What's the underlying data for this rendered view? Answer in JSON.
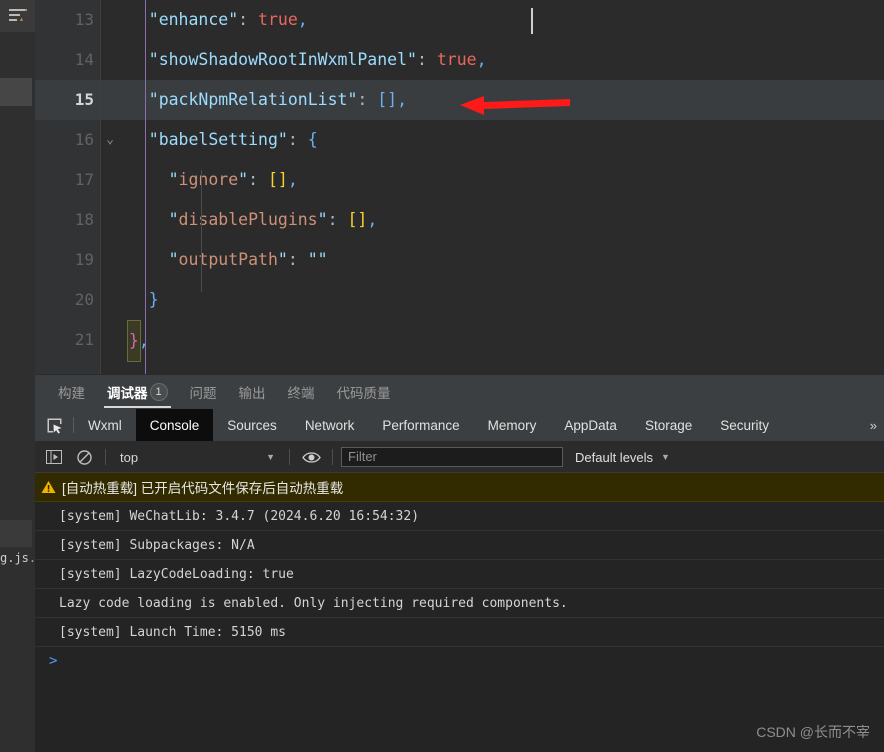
{
  "rail": {
    "outline_icon": "outline-list-icon",
    "file_label_prefix": "g.js",
    "file_label_ellipsis": "..."
  },
  "editor": {
    "lines": [
      {
        "number": "13",
        "active": false,
        "fold": "",
        "indent": "    ",
        "key": "enhance",
        "kind": "top",
        "value": "true",
        "value_kind": "bool",
        "trail": ","
      },
      {
        "number": "14",
        "active": false,
        "fold": "",
        "indent": "    ",
        "key": "showShadowRootInWxmlPanel",
        "kind": "top",
        "value": "true",
        "value_kind": "bool",
        "trail": ","
      },
      {
        "number": "15",
        "active": true,
        "fold": "",
        "indent": "    ",
        "key": "packNpmRelationList",
        "kind": "top",
        "value": "[]",
        "value_kind": "array-blue",
        "trail": ","
      },
      {
        "number": "16",
        "active": false,
        "fold": "chevron-down-icon",
        "indent": "    ",
        "key": "babelSetting",
        "kind": "top",
        "value": "{",
        "value_kind": "brace",
        "trail": ""
      },
      {
        "number": "17",
        "active": false,
        "fold": "",
        "indent": "      ",
        "key": "ignore",
        "kind": "nested",
        "value": "[]",
        "value_kind": "array-yellow",
        "trail": ","
      },
      {
        "number": "18",
        "active": false,
        "fold": "",
        "indent": "      ",
        "key": "disablePlugins",
        "kind": "nested",
        "value": "[]",
        "value_kind": "array-yellow",
        "trail": ","
      },
      {
        "number": "19",
        "active": false,
        "fold": "",
        "indent": "      ",
        "key": "outputPath",
        "kind": "nested",
        "value": "\"\"",
        "value_kind": "string",
        "trail": ""
      },
      {
        "number": "20",
        "active": false,
        "fold": "",
        "indent": "    ",
        "key": "",
        "kind": "brace-close",
        "value": "}",
        "value_kind": "brace",
        "trail": ""
      },
      {
        "number": "21",
        "active": false,
        "fold": "",
        "indent": "  ",
        "key": "",
        "kind": "brace-close-match",
        "value": "}",
        "value_kind": "brace-magenta",
        "trail": ","
      }
    ],
    "annotation_arrow": "red-left-arrow-annotation"
  },
  "tool_tabs": {
    "items": [
      {
        "label": "构建",
        "active": false,
        "badge": ""
      },
      {
        "label": "调试器",
        "active": true,
        "badge": "1"
      },
      {
        "label": "问题",
        "active": false,
        "badge": ""
      },
      {
        "label": "输出",
        "active": false,
        "badge": ""
      },
      {
        "label": "终端",
        "active": false,
        "badge": ""
      },
      {
        "label": "代码质量",
        "active": false,
        "badge": ""
      }
    ]
  },
  "devtools": {
    "inspect_icon": "inspect-element-icon",
    "tabs": [
      {
        "label": "Wxml",
        "active": false
      },
      {
        "label": "Console",
        "active": true
      },
      {
        "label": "Sources",
        "active": false
      },
      {
        "label": "Network",
        "active": false
      },
      {
        "label": "Performance",
        "active": false
      },
      {
        "label": "Memory",
        "active": false
      },
      {
        "label": "AppData",
        "active": false
      },
      {
        "label": "Storage",
        "active": false
      },
      {
        "label": "Security",
        "active": false
      }
    ],
    "overflow_label": "»",
    "toolbar": {
      "sidebar_icon": "console-sidebar-toggle-icon",
      "clear_icon": "clear-console-icon",
      "context_value": "top",
      "context_caret": "▼",
      "eye_icon": "live-expression-eye-icon",
      "filter_placeholder": "Filter",
      "filter_value": "",
      "levels_label": "Default levels",
      "levels_caret": "▼"
    },
    "logs": [
      {
        "level": "warning",
        "icon": "warning-triangle-icon",
        "text": "[自动热重载] 已开启代码文件保存后自动热重载"
      },
      {
        "level": "info",
        "icon": "",
        "text": "[system] WeChatLib: 3.4.7 (2024.6.20 16:54:32)"
      },
      {
        "level": "info",
        "icon": "",
        "text": "[system] Subpackages: N/A"
      },
      {
        "level": "info",
        "icon": "",
        "text": "[system] LazyCodeLoading: true"
      },
      {
        "level": "info",
        "icon": "",
        "text": "Lazy code loading is enabled. Only injecting required components."
      },
      {
        "level": "info",
        "icon": "",
        "text": "[system] Launch Time: 5150 ms"
      }
    ],
    "prompt_symbol": ">"
  },
  "watermark": {
    "text": "CSDN @长而不宰"
  },
  "colors": {
    "editor_bg": "#2b2b2b",
    "gutter_bg": "#313335",
    "active_line": "#3a3d3f",
    "key_blue": "#9cdcfe",
    "key_salmon": "#ce9178",
    "bool_red": "#e8685d",
    "bracket_yellow": "#f7d22d",
    "brace_blue": "#6ab0f3",
    "brace_magenta": "#d664b8",
    "warn_bg": "#332b00",
    "accent_arrow": "#ff1a1a",
    "prompt_blue": "#5c9bf5"
  }
}
